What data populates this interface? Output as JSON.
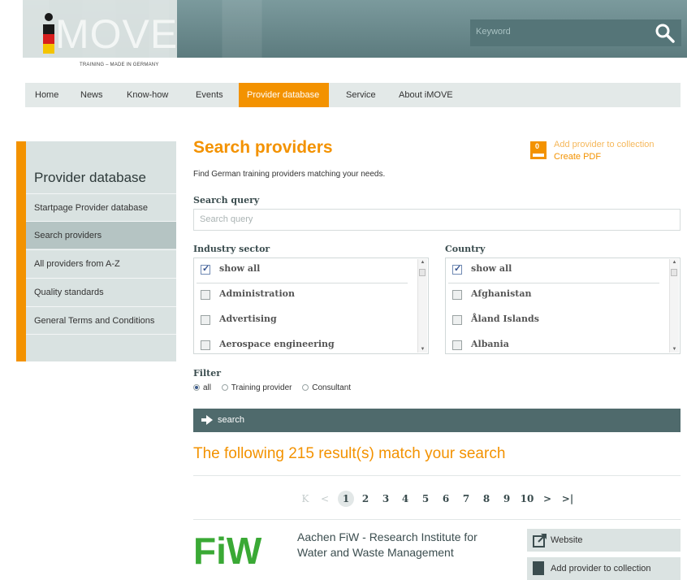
{
  "header": {
    "logo_text": "MOVE",
    "logo_i": "i",
    "tagline": "TRAINING – MADE IN GERMANY",
    "keyword_placeholder": "Keyword",
    "search_icon": "search-icon"
  },
  "nav": {
    "items": [
      {
        "label": "Home"
      },
      {
        "label": "News"
      },
      {
        "label": "Know-how"
      },
      {
        "label": "Events"
      },
      {
        "label": "Provider database",
        "active": true
      },
      {
        "label": "Service"
      },
      {
        "label": "About iMOVE"
      }
    ],
    "accent_color": "#f39200"
  },
  "sidebar": {
    "title": "Provider database",
    "items": [
      {
        "label": "Startpage Provider database"
      },
      {
        "label": "Search providers",
        "active": true
      },
      {
        "label": "All providers from A-Z"
      },
      {
        "label": "Quality standards"
      },
      {
        "label": "General Terms and Conditions"
      }
    ]
  },
  "main": {
    "title": "Search providers",
    "pdf_badge": "0",
    "add_to_collection": "Add provider to collection",
    "create_pdf": "Create PDF",
    "intro": "Find German training providers matching your needs.",
    "search_query_label": "Search query",
    "search_query_placeholder": "Search query",
    "industry": {
      "label": "Industry sector",
      "options": [
        {
          "label": "show all",
          "checked": true
        },
        {
          "label": "Administration",
          "checked": false
        },
        {
          "label": "Advertising",
          "checked": false
        },
        {
          "label": "Aerospace engineering",
          "checked": false
        }
      ]
    },
    "country": {
      "label": "Country",
      "options": [
        {
          "label": "show all",
          "checked": true
        },
        {
          "label": "Afghanistan",
          "checked": false
        },
        {
          "label": "Åland Islands",
          "checked": false
        },
        {
          "label": "Albania",
          "checked": false
        }
      ]
    },
    "filter": {
      "label": "Filter",
      "options": [
        {
          "label": "all",
          "selected": true
        },
        {
          "label": "Training provider",
          "selected": false
        },
        {
          "label": "Consultant",
          "selected": false
        }
      ]
    },
    "search_button": "search",
    "results_heading": "The following 215 result(s) match your search",
    "pagination": {
      "first": "K",
      "prev": "<",
      "pages": [
        "1",
        "2",
        "3",
        "4",
        "5",
        "6",
        "7",
        "8",
        "9",
        "10"
      ],
      "current": "1",
      "next": ">",
      "last": ">|"
    },
    "result": {
      "logo_text": "FiW",
      "name": "Aachen FiW - Research Institute for Water and Waste Management",
      "website_button": "Website",
      "add_button": "Add provider to collection"
    }
  }
}
